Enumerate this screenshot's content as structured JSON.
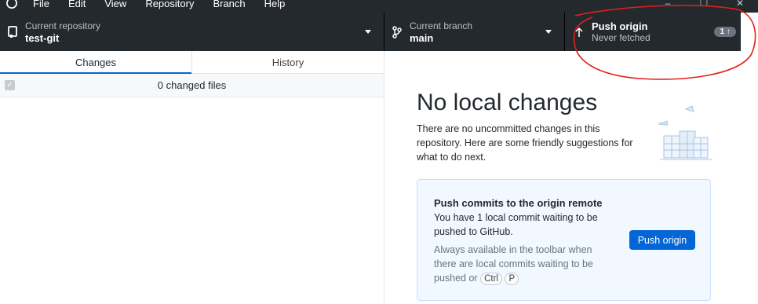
{
  "menu": {
    "items": [
      "File",
      "Edit",
      "View",
      "Repository",
      "Branch",
      "Help"
    ]
  },
  "toolbar": {
    "repository": {
      "label": "Current repository",
      "value": "test-git"
    },
    "branch": {
      "label": "Current branch",
      "value": "main"
    },
    "push": {
      "label": "Push origin",
      "sub": "Never fetched",
      "badge": "1"
    }
  },
  "tabs": [
    "Changes",
    "History"
  ],
  "changes": {
    "count_label": "0 changed files"
  },
  "empty_state": {
    "title": "No local changes",
    "description": "There are no uncommitted changes in this repository. Here are some friendly suggestions for what to do next."
  },
  "suggestion": {
    "title": "Push commits to the origin remote",
    "description": "You have 1 local commit waiting to be pushed to GitHub.",
    "hint_prefix": "Always available in the toolbar when there are local commits waiting to be pushed or",
    "shortcut_keys": [
      "Ctrl",
      "P"
    ],
    "button_label": "Push origin"
  },
  "colors": {
    "toolbar_bg": "#24292e",
    "accent_blue": "#0366d6",
    "annotation_red": "#e0201b"
  }
}
